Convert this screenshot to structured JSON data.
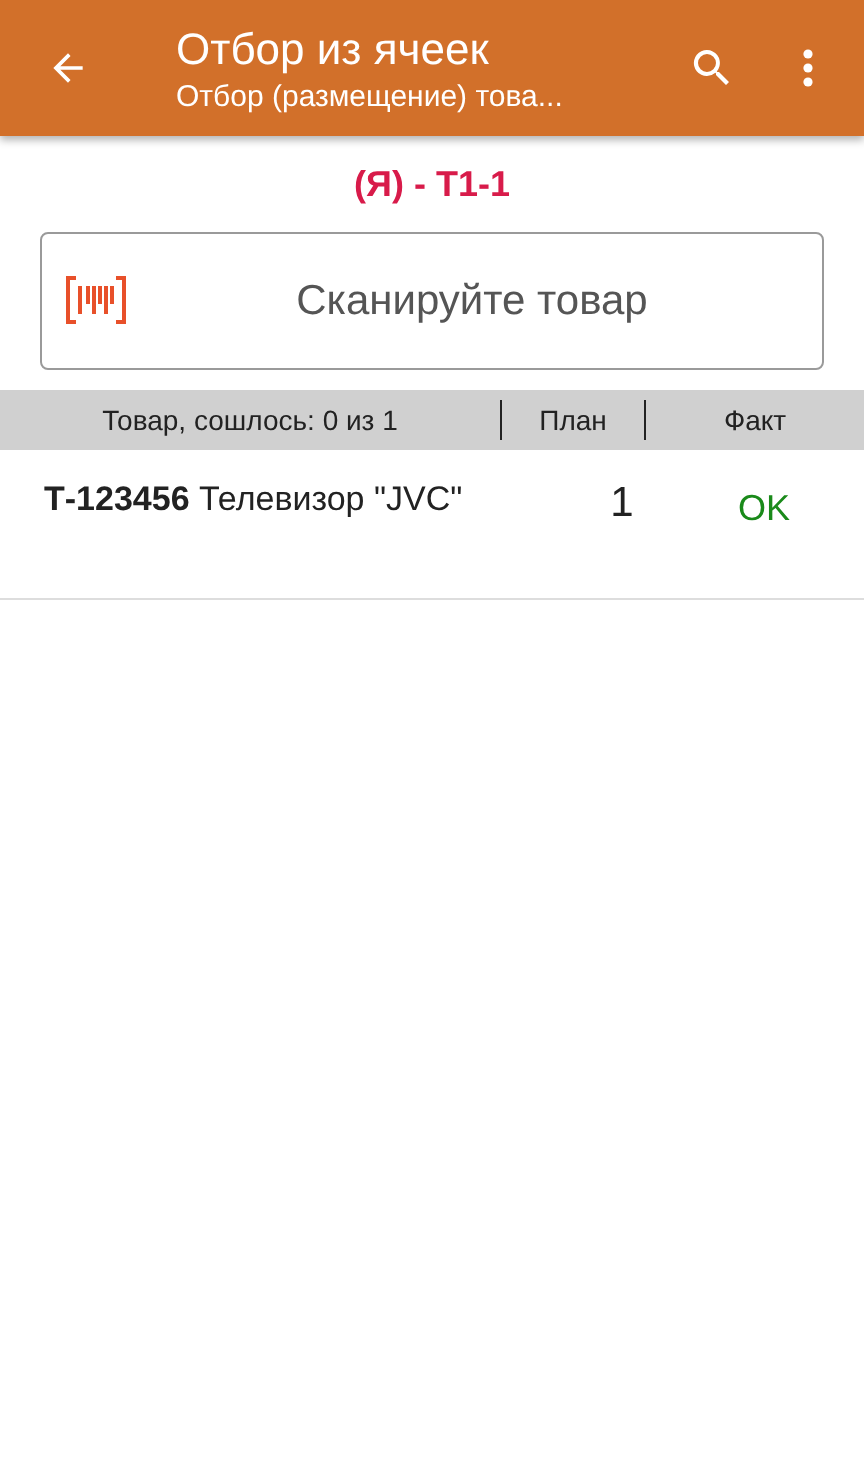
{
  "app_bar": {
    "title": "Отбор из ячеек",
    "subtitle": "Отбор (размещение) това..."
  },
  "cell": "(Я) - Т1-1",
  "scan_field": {
    "placeholder": "Сканируйте товар"
  },
  "table": {
    "columns": [
      "Товар, сошлось: 0 из 1",
      "План",
      "Факт"
    ],
    "rows": [
      {
        "item": "**Т-123456** Телевизор \"JVC\"",
        "plan": "1",
        "fact": "OK"
      }
    ]
  }
}
